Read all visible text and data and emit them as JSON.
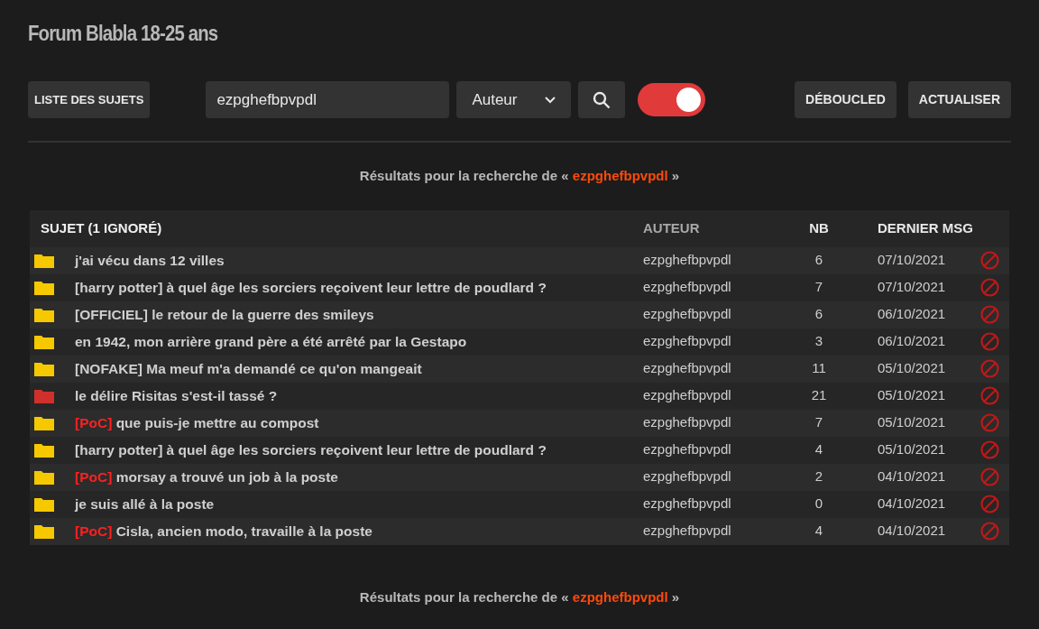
{
  "title": "Forum Blabla 18-25 ans",
  "toolbar": {
    "topics_button": "LISTE DES SUJETS",
    "search": {
      "value": "ezpghefbpvpdl"
    },
    "filter": {
      "value": "Auteur"
    },
    "toggle": {
      "on": true
    },
    "buttons": [
      "DÉBOUCLED",
      "ACTUALISER"
    ]
  },
  "results_top": {
    "prefix": "Résultats pour la recherche de «",
    "query": "ezpghefbpvpdl",
    "suffix": "»"
  },
  "table": {
    "columns": [
      "SUJET (1 IGNORÉ)",
      "AUTEUR",
      "NB",
      "DERNIER MSG"
    ],
    "rows": [
      {
        "color": "#f5c800",
        "title": "j'ai vécu dans 12 villes",
        "author": "ezpghefbpvpdl",
        "nb": "6",
        "date": "07/10/2021"
      },
      {
        "color": "#f5c800",
        "title": "[harry potter] à quel âge les sorciers reçoivent leur lettre de poudlard ?",
        "author": "ezpghefbpvpdl",
        "nb": "7",
        "date": "07/10/2021"
      },
      {
        "color": "#f5c800",
        "title": "[OFFICIEL] le retour de la guerre des smileys",
        "author": "ezpghefbpvpdl",
        "nb": "6",
        "date": "06/10/2021"
      },
      {
        "color": "#f5c800",
        "title": "en 1942, mon arrière grand père a été arrêté par la Gestapo",
        "author": "ezpghefbpvpdl",
        "nb": "3",
        "date": "06/10/2021"
      },
      {
        "color": "#f5c800",
        "title": "[NOFAKE] Ma meuf m'a demandé ce qu'on mangeait",
        "author": "ezpghefbpvpdl",
        "nb": "11",
        "date": "05/10/2021"
      },
      {
        "color": "#d0302b",
        "title": "le délire Risitas s'est-il tassé ?",
        "author": "ezpghefbpvpdl",
        "nb": "21",
        "date": "05/10/2021"
      },
      {
        "color": "#f5c800",
        "tag": "[PoC]",
        "title": "que puis-je mettre au compost",
        "author": "ezpghefbpvpdl",
        "nb": "7",
        "date": "05/10/2021"
      },
      {
        "color": "#f5c800",
        "title": "[harry potter] à quel âge les sorciers reçoivent leur lettre de poudlard ?",
        "author": "ezpghefbpvpdl",
        "nb": "4",
        "date": "05/10/2021"
      },
      {
        "color": "#f5c800",
        "tag": "[PoC]",
        "title": "morsay a trouvé un job à la poste",
        "author": "ezpghefbpvpdl",
        "nb": "2",
        "date": "04/10/2021"
      },
      {
        "color": "#f5c800",
        "title": "je suis allé à la poste",
        "author": "ezpghefbpvpdl",
        "nb": "0",
        "date": "04/10/2021"
      },
      {
        "color": "#f5c800",
        "tag": "[PoC]",
        "title": "Cisla, ancien modo, travaille à la poste",
        "author": "ezpghefbpvpdl",
        "nb": "4",
        "date": "04/10/2021"
      }
    ]
  },
  "results_bottom": {
    "prefix": "Résultats pour la recherche de «",
    "query": "ezpghefbpvpdl",
    "suffix": "»"
  }
}
